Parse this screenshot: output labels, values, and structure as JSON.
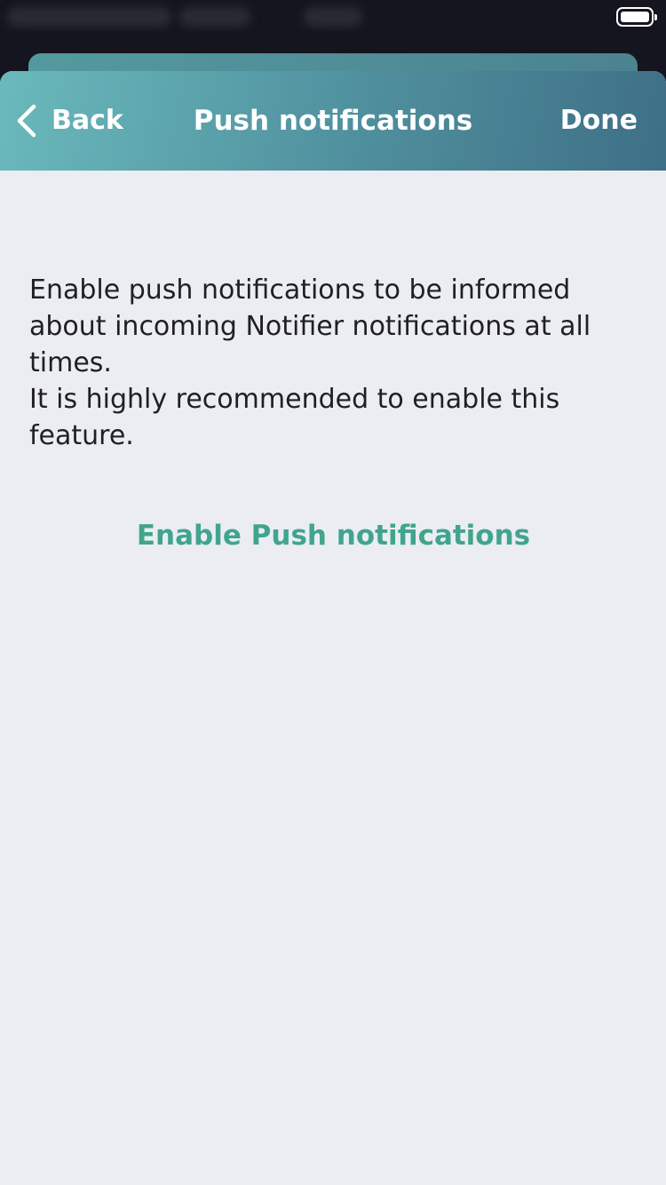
{
  "nav": {
    "back_label": "Back",
    "title": "Push notifications",
    "done_label": "Done"
  },
  "content": {
    "description": "Enable push notifications to be informed about incoming Notifier notifications at all times.\nIt is highly recommended to enable this feature.",
    "enable_button": "Enable Push notifications"
  },
  "colors": {
    "accent": "#41a58d",
    "header_gradient_start": "#6ab9bc",
    "header_gradient_end": "#3e6f86",
    "background": "#ebedf2",
    "text": "#1f1f24"
  },
  "icons": {
    "back": "chevron-left",
    "battery": "battery-full"
  }
}
